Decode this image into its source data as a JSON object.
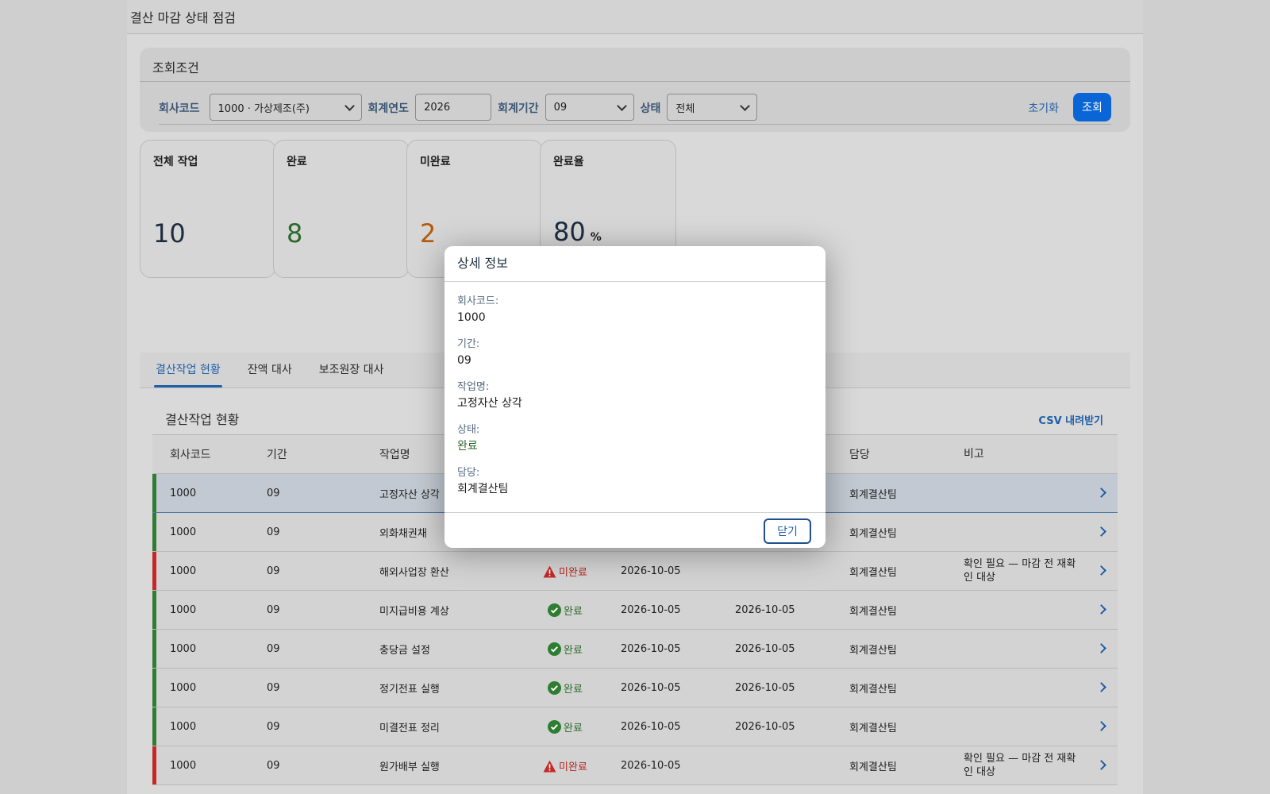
{
  "app": {
    "title": "결산 마감 상태 점검"
  },
  "filter": {
    "title": "조회조건",
    "company_label": "회사코드",
    "company_value": "1000 · 가상제조(주)",
    "year_label": "회계연도",
    "year_value": "2026",
    "period_label": "회계기간",
    "period_value": "09",
    "status_label": "상태",
    "status_value": "전체",
    "reset_label": "초기화",
    "search_label": "조회"
  },
  "kpis": [
    {
      "title": "전체 작업",
      "value": "10",
      "unit": ""
    },
    {
      "title": "완료",
      "value": "8",
      "unit": ""
    },
    {
      "title": "미완료",
      "value": "2",
      "unit": ""
    },
    {
      "title": "완료율",
      "value": "80",
      "unit": "%"
    }
  ],
  "tabs": [
    "결산작업 현황",
    "잔액 대사",
    "보조원장 대사"
  ],
  "section": {
    "title": "결산작업 현황",
    "csv_label": "CSV 내려받기"
  },
  "table": {
    "headers": [
      "회사코드",
      "기간",
      "작업명",
      "",
      "",
      "",
      "담당",
      "비고"
    ],
    "rows": [
      {
        "company": "1000",
        "period": "09",
        "task": "고정자산 상각",
        "status": "",
        "due": "",
        "done": "",
        "owner": "회계결산팀",
        "note": ""
      },
      {
        "company": "1000",
        "period": "09",
        "task": "외화채권채",
        "status": "",
        "due": "",
        "done": "",
        "owner": "회계결산팀",
        "note": ""
      },
      {
        "company": "1000",
        "period": "09",
        "task": "해외사업장 환산",
        "status": "미완료",
        "due": "2026-10-05",
        "done": "",
        "owner": "회계결산팀",
        "note": "확인 필요 — 마감 전 재확인 대상"
      },
      {
        "company": "1000",
        "period": "09",
        "task": "미지급비용 계상",
        "status": "완료",
        "due": "2026-10-05",
        "done": "2026-10-05",
        "owner": "회계결산팀",
        "note": ""
      },
      {
        "company": "1000",
        "period": "09",
        "task": "충당금 설정",
        "status": "완료",
        "due": "2026-10-05",
        "done": "2026-10-05",
        "owner": "회계결산팀",
        "note": ""
      },
      {
        "company": "1000",
        "period": "09",
        "task": "정기전표 실행",
        "status": "완료",
        "due": "2026-10-05",
        "done": "2026-10-05",
        "owner": "회계결산팀",
        "note": ""
      },
      {
        "company": "1000",
        "period": "09",
        "task": "미결전표 정리",
        "status": "완료",
        "due": "2026-10-05",
        "done": "2026-10-05",
        "owner": "회계결산팀",
        "note": ""
      },
      {
        "company": "1000",
        "period": "09",
        "task": "원가배부 실행",
        "status": "미완료",
        "due": "2026-10-05",
        "done": "",
        "owner": "회계결산팀",
        "note": "확인 필요 — 마감 전 재확인 대상"
      }
    ]
  },
  "dialog": {
    "title": "상세 정보",
    "company_label": "회사코드:",
    "company_value": "1000",
    "period_label": "기간:",
    "period_value": "09",
    "task_label": "작업명:",
    "task_value": "고정자산 상각",
    "status_label": "상태:",
    "status_value": "완료",
    "owner_label": "담당:",
    "owner_value": "회계결산팀",
    "close_label": "닫기"
  },
  "colors": {
    "accent": "#0a66d6",
    "ok": "#2e7d32",
    "bad": "#c62828",
    "pending": "#b55a0c"
  }
}
